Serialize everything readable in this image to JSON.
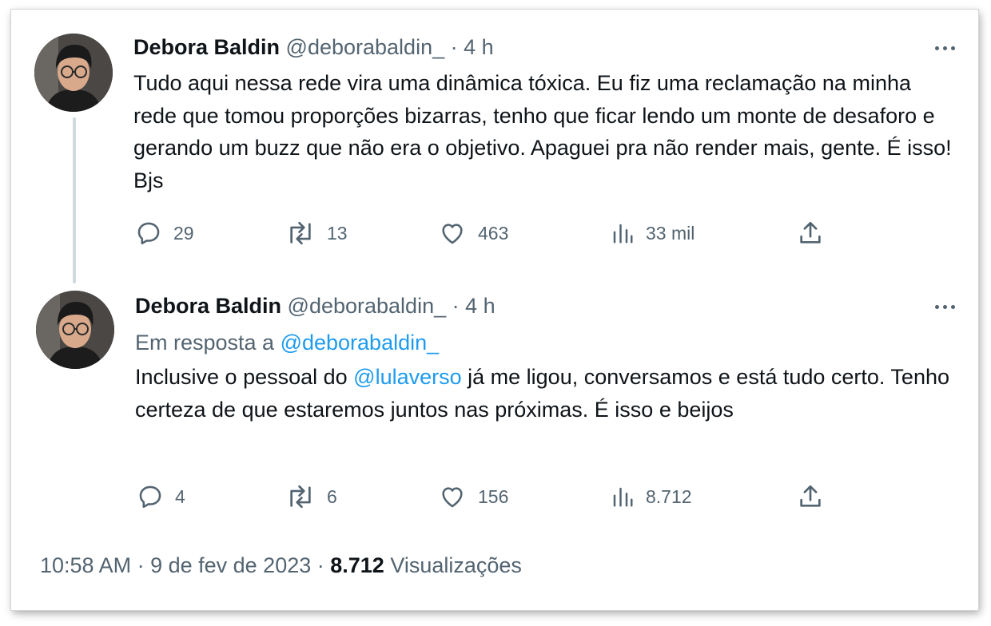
{
  "tweets": [
    {
      "author_name": "Debora Baldin",
      "handle": "@deborabaldin_",
      "sep": "·",
      "time": "4 h",
      "text": "Tudo aqui nessa rede vira uma dinâmica tóxica. Eu fiz uma reclamação na minha rede que tomou proporções bizarras, tenho que ficar lendo um monte de desaforo e gerando um buzz que não era o objetivo. Apaguei pra não render mais, gente. É isso! Bjs",
      "replies": "29",
      "retweets": "13",
      "likes": "463",
      "views": "33 mil"
    },
    {
      "author_name": "Debora Baldin",
      "handle": "@deborabaldin_",
      "sep": "·",
      "time": "4 h",
      "reply_prefix": "Em resposta a ",
      "reply_handle": "@deborabaldin_",
      "text_before": "Inclusive o pessoal do ",
      "mention": "@lulaverso",
      "text_after": " já me ligou, conversamos e está tudo certo. Tenho certeza de que estaremos juntos nas próximas. É isso e beijos",
      "replies": "4",
      "retweets": "6",
      "likes": "156",
      "views": "8.712"
    }
  ],
  "footer": {
    "timestamp": "10:58 AM · 9 de fev de 2023 · ",
    "views_count": "8.712",
    "views_label": " Visualizações"
  },
  "icons": {
    "reply": "reply-icon",
    "retweet": "retweet-icon",
    "like": "heart-icon",
    "views": "views-chart-icon",
    "share": "share-icon",
    "more": "more-dots-icon"
  },
  "colors": {
    "text": "#0f1419",
    "secondary": "#536471",
    "link": "#1d9bf0",
    "thread_line": "#cfd9de"
  }
}
